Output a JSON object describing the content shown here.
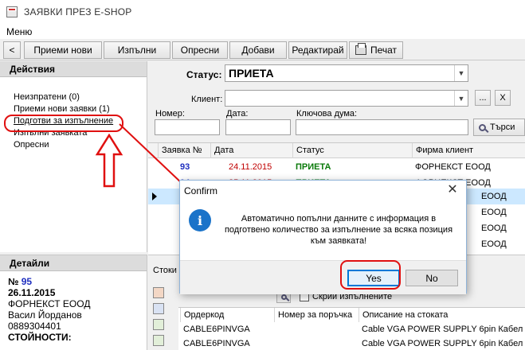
{
  "window": {
    "title": "ЗАЯВКИ ПРЕЗ E-SHOP"
  },
  "menu": {
    "label": "Меню"
  },
  "toolbar": {
    "back": "<",
    "receive_new": "Приеми нови",
    "execute": "Изпълни",
    "refresh": "Опресни",
    "add": "Добави",
    "edit": "Редактирай",
    "print": "Печат"
  },
  "actions": {
    "title": "Действия",
    "items": [
      "Неизпратени (0)",
      "Приеми нови заявки (1)",
      "Подготви за изпълнение",
      "Изпълни заявката",
      "Опресни"
    ]
  },
  "details": {
    "title": "Детайли",
    "number_prefix": "№",
    "number": "95",
    "date": "26.11.2015",
    "company": "ФОРНЕКСТ ЕООД",
    "person": "Васил Йорданов",
    "phone": "0889304401",
    "costs_label": "СТОЙНОСТИ:"
  },
  "filters": {
    "status_label": "Статус:",
    "status_value": "ПРИЕТА",
    "client_label": "Клиент:",
    "number_label": "Номер:",
    "date_label": "Дата:",
    "keyword_label": "Ключова дума:",
    "browse": "...",
    "clear": "X",
    "search_button": "Търси"
  },
  "orders": {
    "columns": [
      "Заявка №",
      "Дата",
      "Статус",
      "Фирма клиент"
    ],
    "rows": [
      {
        "number": "93",
        "date": "24.11.2015",
        "status": "ПРИЕТА",
        "company": "ФОРНЕКСТ ЕООД"
      },
      {
        "number": "94",
        "date": "25.11.2015",
        "status": "ПРИЕТА",
        "company": "ФОРНЕКСТ ЕООД"
      },
      {
        "number": "",
        "date": "",
        "status": "",
        "company": "ЕООД"
      },
      {
        "number": "",
        "date": "",
        "status": "",
        "company": "ЕООД"
      },
      {
        "number": "",
        "date": "",
        "status": "",
        "company": "ЕООД"
      },
      {
        "number": "",
        "date": "",
        "status": "",
        "company": "ЕООД"
      }
    ]
  },
  "bottom": {
    "tab_label": "Стоки",
    "hide_executed_label": "Скрий изпълнените",
    "columns": [
      "Ордеркод",
      "Номер за поръчка",
      "Описание на стоката"
    ],
    "rows": [
      {
        "code": "CABLE6PINVGA",
        "order_no": "",
        "desc": "Cable VGA POWER SUPPLY 6pin Кабел"
      },
      {
        "code": "CABLE6PINVGA",
        "order_no": "",
        "desc": "Cable VGA POWER SUPPLY 6pin Кабел"
      }
    ]
  },
  "dialog": {
    "title": "Confirm",
    "close": "✕",
    "icon": "i",
    "message": "Автоматично попълни данните с информация в подготвено количество за изпълнение за всяка позиция към заявката!",
    "yes": "Yes",
    "no": "No"
  },
  "colors": {
    "order_number": "#1f2fbf",
    "order_date": "#c00000",
    "status_ok": "#0a7a0a",
    "annotation": "#e01010",
    "selection": "#cce8ff"
  }
}
